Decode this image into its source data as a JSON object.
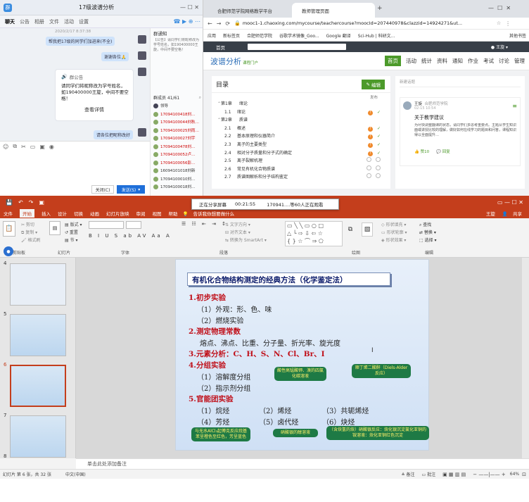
{
  "chat": {
    "title": "17级波谱分析",
    "tabs": [
      "聊天",
      "公告",
      "相册",
      "文件",
      "活动",
      "设置"
    ],
    "timestamp": "2020/2/17 8:37:38",
    "msg1": "帮我把17级的同学们加进来(不全)",
    "msg2": "谢谢各位🙏",
    "notice_header": "群公告",
    "notice_body": "请同学们将昵称改为学号姓名，如190400000王旋，中间不要空格！",
    "notice_link": "查看详情",
    "msg3": "请各位把昵称改好",
    "side_title": "群通知",
    "side_body": "【公告】请同学们将昵称改为学号姓名，如190400000王旋，中间不要空格！",
    "members_header": "群成员 41/61",
    "members": [
      "领导",
      "17094100418刘…",
      "17094100044刘秋…",
      "17094100025刘雨…",
      "17094100027刘宇",
      "17094100478刘…",
      "17094100052卢…",
      "17094100056彭…",
      "16094101018刘新",
      "17094100010刘…",
      "17094100018刘…"
    ],
    "close_btn": "关闭(C)",
    "send_btn": "发送(S)"
  },
  "browser": {
    "tab1": "合肥师范学院网络教学平台",
    "tab2": "教师管理页面",
    "url": "mooc1-1.chaoxing.com/mycourse/teachercourse?moocId=207440978&clazzid=14924271&ut...",
    "bookmarks": [
      "应用",
      "新标签页",
      "合肥师范学院",
      "谷歌学术镜像_Goo...",
      "Google 翻译",
      "Sci-Hub | 科研文...",
      "其他书签"
    ],
    "site_home": "首页",
    "user": "王旋",
    "course_title": "波谱分析",
    "course_sub": "课程门户",
    "nav": [
      "首页",
      "活动",
      "统计",
      "资料",
      "通知",
      "作业",
      "考试",
      "讨论",
      "管理"
    ],
    "outline_title": "目录",
    "edit_btn": "编辑",
    "pub_label": "发布",
    "chapters": [
      {
        "num": "第1章",
        "title": "绪论",
        "kind": "chapter"
      },
      {
        "num": "1.1",
        "title": "绪论",
        "kind": "done"
      },
      {
        "num": "第2章",
        "title": "质谱",
        "kind": "chapter"
      },
      {
        "num": "2.1",
        "title": "概述",
        "kind": "done"
      },
      {
        "num": "2.2",
        "title": "基本原理和仪器简介",
        "kind": "done"
      },
      {
        "num": "2.3",
        "title": "离子的主要类型",
        "kind": "done"
      },
      {
        "num": "2.4",
        "title": "相对分子质量和分子式的确定",
        "kind": "done"
      },
      {
        "num": "2.5",
        "title": "离子裂解机理",
        "kind": "todo"
      },
      {
        "num": "2.6",
        "title": "常见有机化合物质谱",
        "kind": "todo"
      },
      {
        "num": "2.7",
        "title": "质谱图解析和分子结构鉴定",
        "kind": "todo"
      }
    ],
    "notice_placeholder": "新建话题",
    "post_user": "王旋",
    "post_school": "合肥师范学院",
    "post_time": "02-15 10:54",
    "post_title": "关于教学建议",
    "post_body": "为尽快调整翻课的状态，请同学们多思考重要点。主题从学生知识面或讲授比较的理解，做好如何在线学习的题目和问答，课程知识得以全面提升…",
    "post_likes": "赞10",
    "post_reply": "回复"
  },
  "ppt": {
    "banner_label": "正在分享屏幕",
    "banner_time": "00:21:55",
    "banner_viewers": "170941....等60人正在观看",
    "menu": [
      "文件",
      "开始",
      "插入",
      "设计",
      "切换",
      "动画",
      "幻灯片放映",
      "审阅",
      "视图",
      "帮助"
    ],
    "tell_me": "告诉我你想要做什么",
    "user": "王旋",
    "share": "共享",
    "group_labels": [
      "剪贴板",
      "幻灯片",
      "字体",
      "段落",
      "绘图",
      "编辑"
    ],
    "slide_title": "有机化合物结构测定的经典方法（化学鉴定法）",
    "lines": [
      {
        "t": "1.初步实验",
        "h": true
      },
      {
        "t": "（1）外观：形、色、味",
        "h": false
      },
      {
        "t": "（2）燃烧实验",
        "h": false
      },
      {
        "t": "2.测定物理常数",
        "h": true
      },
      {
        "t": "熔点、沸点、比重、分子量、折光率、旋光度",
        "h": false
      },
      {
        "t": "3.元素分析：C、H、S、N、Cl、Br、I",
        "h": true
      },
      {
        "t": "4.分组实验",
        "h": true
      },
      {
        "t": "（1）溶解度分组",
        "h": false
      },
      {
        "t": "（2）指示剂分组",
        "h": false
      },
      {
        "t": "5.官能团实验",
        "h": true
      }
    ],
    "grid": [
      "（1）烷烃",
      "（2）烯烃",
      "（3）共轭烯烃",
      "（4）芳烃",
      "（5）卤代烃",
      "（6）炔烃"
    ],
    "callout1": "酸性高锰酸钾、溴的四氯化碳溶液",
    "callout2": "顺丁烯二酸酐（Diels-Alder反应）",
    "callout3": "与无水AlCl₃起傅克反应烷基苯呈橙色至红色，芳呈蓝色",
    "callout4": "硝酸银的醇溶液",
    "callout5": "（含炔氢的炔）硝酸银反应：炔化银沉淀氯化亚铜的铵溶液：炔化亚铜红色沉淀",
    "thumb_nums": [
      "4",
      "5",
      "6",
      "7",
      "8"
    ],
    "notes": "单击此处添加备注",
    "status_left": "幻灯片 第 6 张，共 32 张",
    "status_lang": "中文(中国)",
    "status_notes": "备注",
    "status_comments": "批注",
    "zoom": "64%"
  },
  "colors": {
    "ppt_red": "#c43e1c",
    "slide_title_blue": "#0a1a6a",
    "heading_red": "#c0101a",
    "callout_green": "#1e7a45",
    "chaoxing_green": "#4c9a2a"
  }
}
